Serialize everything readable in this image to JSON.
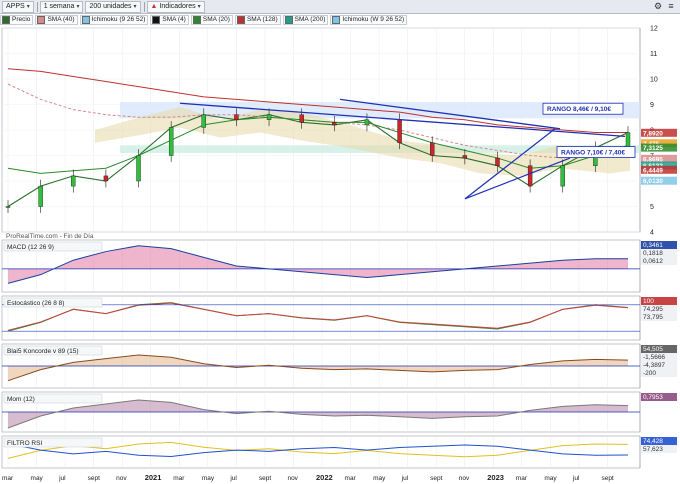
{
  "toolbar": {
    "symbol": "APPS",
    "period": "1 semana",
    "units": "200 unidades",
    "indicators": "Indicadores"
  },
  "legend": [
    {
      "label": "Precio",
      "color": "#2b6e2b"
    },
    {
      "label": "SMA (40)",
      "color": "#d88a8a"
    },
    {
      "label": "Ichimoku (9 26 52)",
      "color": "#7fc4e6"
    },
    {
      "label": "SMA (4)",
      "color": "#111111"
    },
    {
      "label": "SMA (20)",
      "color": "#2a8a2a"
    },
    {
      "label": "SMA (128)",
      "color": "#c03030"
    },
    {
      "label": "SMA (200)",
      "color": "#20a08a"
    },
    {
      "label": "Ichimoku (W 9 26 52)",
      "color": "#7fc4e6"
    }
  ],
  "watermark": "ProRealTime.com - Fin de Día",
  "annotations": {
    "range_high": "RANGO 8,46€ / 9,10€",
    "range_low": "RANGO 7,10€ / 7,40€"
  },
  "price_labels": {
    "last": "7,8920",
    "l2": "7,475",
    "l3": "7,3125",
    "l4": "6,8695",
    "l5": "6,6132",
    "l6": "6,4449",
    "l7": "6,0130"
  },
  "panels": {
    "macd": {
      "title": "MACD (12 26 9)",
      "values": [
        "0,3461",
        "0,1818",
        "0,0612"
      ]
    },
    "stoch": {
      "title": "Estocástico (26 8 8)",
      "values": [
        "100",
        "74,295",
        "73,795"
      ]
    },
    "blai": {
      "title": "Blai5 Koncorde v 89 (15)",
      "values": [
        "54,505",
        "-1,5666",
        "-4,3897",
        "-200"
      ]
    },
    "momentum": {
      "title": "Mom (12)",
      "values": [
        "0,7953"
      ]
    },
    "filtro": {
      "title": "FILTRO RSI",
      "values": [
        "74,428",
        "57,623"
      ]
    }
  },
  "x_axis_labels": [
    "mar",
    "may",
    "jul",
    "sept",
    "nov",
    "2021",
    "mar",
    "may",
    "jul",
    "sept",
    "nov",
    "2022",
    "mar",
    "may",
    "jul",
    "sept",
    "nov",
    "2023",
    "mar",
    "may",
    "jul",
    "sept"
  ],
  "chart_data": {
    "type": "line",
    "title": "APPS",
    "xlabel": "",
    "ylabel": "",
    "ylim": [
      4,
      12
    ],
    "y_ticks": [
      4,
      5,
      6,
      7,
      8,
      9,
      10,
      11,
      12
    ],
    "x": [
      "2020-03",
      "2020-05",
      "2020-07",
      "2020-09",
      "2020-11",
      "2021-01",
      "2021-03",
      "2021-05",
      "2021-07",
      "2021-09",
      "2021-11",
      "2022-01",
      "2022-03",
      "2022-05",
      "2022-07",
      "2022-09",
      "2022-11",
      "2023-01",
      "2023-03",
      "2023-04"
    ],
    "series": [
      {
        "name": "Precio",
        "values": [
          5.0,
          5.8,
          6.2,
          6.0,
          7.0,
          8.1,
          8.6,
          8.4,
          8.6,
          8.3,
          8.2,
          8.4,
          7.5,
          7.0,
          6.9,
          6.6,
          5.8,
          6.6,
          7.3,
          7.9
        ]
      },
      {
        "name": "SMA (40)",
        "values": [
          9.8,
          9.2,
          8.8,
          8.6,
          8.5,
          8.5,
          8.6,
          8.6,
          8.5,
          8.4,
          8.3,
          8.2,
          8.0,
          7.7,
          7.4,
          7.2,
          7.0,
          6.9,
          7.0,
          7.1
        ]
      },
      {
        "name": "SMA (128)",
        "values": [
          10.4,
          10.3,
          10.1,
          9.9,
          9.7,
          9.5,
          9.3,
          9.2,
          9.1,
          9.0,
          8.9,
          8.8,
          8.7,
          8.5,
          8.4,
          8.2,
          8.1,
          8.0,
          7.9,
          7.9
        ]
      },
      {
        "name": "SMA (20)",
        "values": [
          6.5,
          6.3,
          6.4,
          6.5,
          7.0,
          7.6,
          8.2,
          8.4,
          8.5,
          8.4,
          8.3,
          8.3,
          7.9,
          7.5,
          7.2,
          6.9,
          6.5,
          6.6,
          7.0,
          7.4
        ]
      }
    ]
  },
  "indicator_data": {
    "macd": [
      -0.5,
      -0.2,
      0.3,
      0.6,
      0.8,
      0.7,
      0.4,
      0.1,
      0.0,
      -0.1,
      -0.2,
      -0.3,
      -0.2,
      -0.1,
      0.0,
      0.1,
      0.2,
      0.3,
      0.35,
      0.35
    ],
    "stoch": [
      20,
      40,
      70,
      60,
      80,
      85,
      70,
      55,
      60,
      50,
      45,
      55,
      40,
      35,
      30,
      25,
      40,
      70,
      80,
      74
    ],
    "momentum": [
      -2.0,
      -0.5,
      0.5,
      1.0,
      1.5,
      1.2,
      0.3,
      -0.2,
      0.1,
      -0.3,
      -0.5,
      -0.4,
      -0.6,
      -0.8,
      -0.6,
      -0.5,
      0.2,
      0.7,
      0.9,
      0.8
    ],
    "filtro_rsi": [
      30,
      55,
      70,
      60,
      75,
      80,
      65,
      55,
      60,
      50,
      45,
      55,
      45,
      40,
      35,
      40,
      55,
      70,
      75,
      74
    ]
  }
}
